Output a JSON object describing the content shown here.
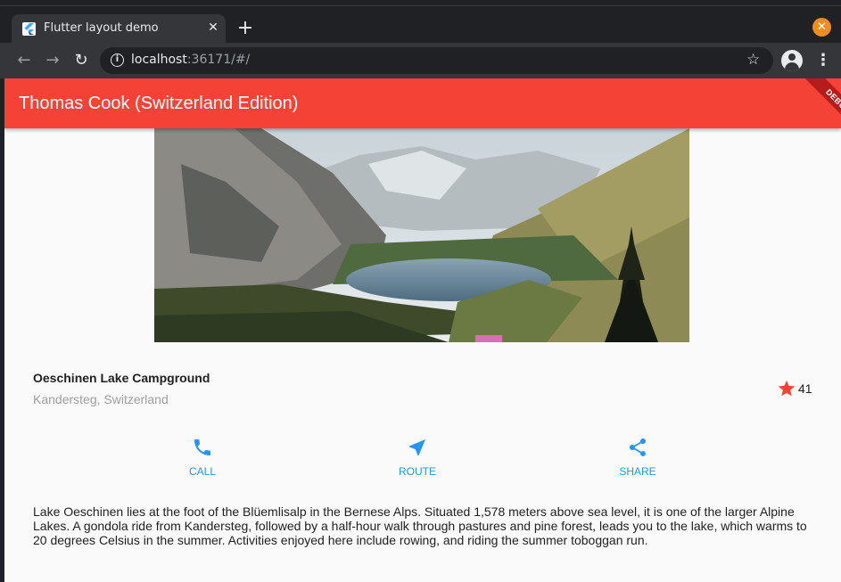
{
  "browser": {
    "tab_title": "Flutter layout demo",
    "url_host": "localhost",
    "url_rest": ":36171/#/",
    "icons": {
      "favicon": "flutter-logo-icon",
      "tab_close": "close-icon",
      "new_tab": "plus-icon",
      "window_close": "close-circle-icon",
      "back": "arrow-left-icon",
      "forward": "arrow-right-icon",
      "reload": "reload-icon",
      "site_info": "info-icon",
      "bookmark": "star-outline-icon",
      "profile": "account-icon",
      "menu": "more-vertical-icon"
    }
  },
  "app": {
    "title": "Thomas Cook (Switzerland Edition)",
    "debug_banner": "DEBUG",
    "accent_color": "#f44336",
    "action_color": "#2196f3",
    "place": {
      "name": "Oeschinen Lake Campground",
      "location": "Kandersteg, Switzerland",
      "favorite_count": "41"
    },
    "actions": [
      {
        "label": "CALL",
        "icon": "phone-icon"
      },
      {
        "label": "ROUTE",
        "icon": "navigation-icon"
      },
      {
        "label": "SHARE",
        "icon": "share-icon"
      }
    ],
    "description": "Lake Oeschinen lies at the foot of the Blüemlisalp in the Bernese Alps. Situated 1,578 meters above sea level, it is one of the larger Alpine Lakes. A gondola ride from Kandersteg, followed by a half-hour walk through pastures and pine forest, leads you to the lake, which warms to 20 degrees Celsius in the summer. Activities enjoyed here include rowing, and riding the summer toboggan run."
  }
}
